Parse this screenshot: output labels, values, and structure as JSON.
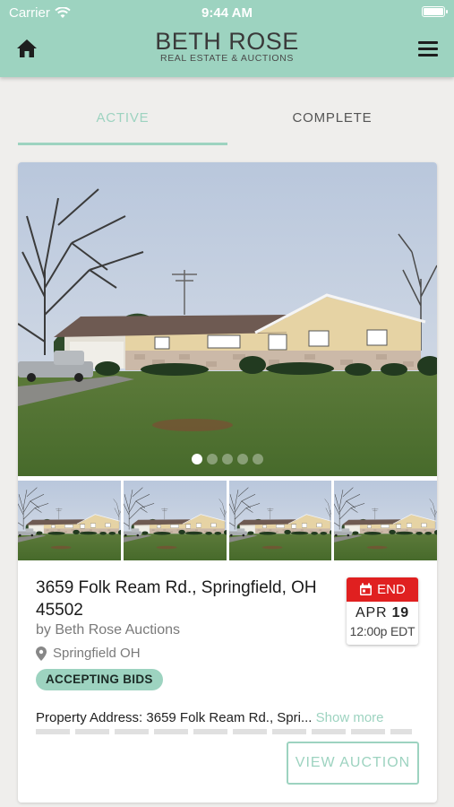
{
  "status": {
    "carrier": "Carrier",
    "time": "9:44 AM"
  },
  "header": {
    "logo_line1": "BETH ROSE",
    "logo_line2": "REAL ESTATE & AUCTIONS",
    "home_icon": "home-icon",
    "menu_icon": "hamburger-menu-icon"
  },
  "tabs": [
    {
      "label": "ACTIVE",
      "selected": true
    },
    {
      "label": "COMPLETE",
      "selected": false
    }
  ],
  "listing": {
    "gallery": {
      "total_images": 5,
      "current_index": 1
    },
    "title": "3659 Folk Ream Rd., Springfield, OH 45502",
    "byline": "by Beth Rose Auctions",
    "location": "Springfield OH",
    "badge": "ACCEPTING BIDS",
    "end": {
      "label": "END",
      "month": "APR",
      "day": "19",
      "time": "12:00p EDT"
    },
    "description": "Property Address: 3659 Folk Ream Rd., Spri...",
    "show_more": "Show more",
    "view_button": "VIEW AUCTION"
  },
  "colors": {
    "accent": "#9dd3c0",
    "end_red": "#e02020",
    "background": "#efeeec"
  }
}
